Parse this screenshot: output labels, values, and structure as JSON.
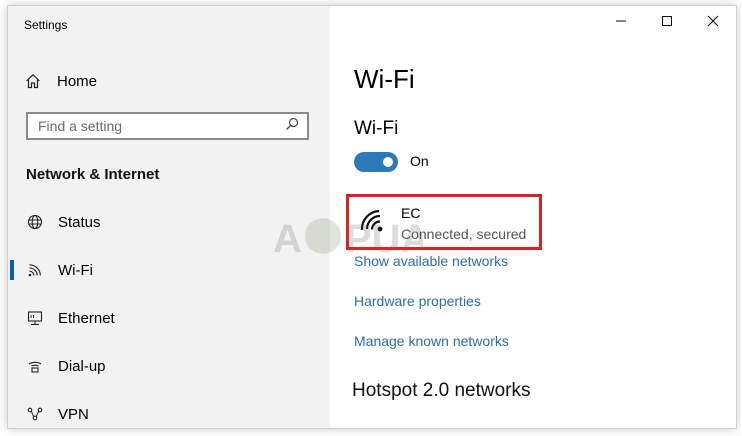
{
  "window": {
    "title": "Settings"
  },
  "titlebar": {
    "minimize_icon": "minimize-icon",
    "maximize_icon": "maximize-icon",
    "close_icon": "close-icon"
  },
  "sidebar": {
    "home": {
      "label": "Home",
      "icon": "home-icon"
    },
    "search": {
      "placeholder": "Find a setting",
      "value": "",
      "icon": "search-icon"
    },
    "section_title": "Network & Internet",
    "items": [
      {
        "label": "Status",
        "icon": "globe-icon",
        "selected": false
      },
      {
        "label": "Wi-Fi",
        "icon": "wifi-icon",
        "selected": true
      },
      {
        "label": "Ethernet",
        "icon": "ethernet-icon",
        "selected": false
      },
      {
        "label": "Dial-up",
        "icon": "dialup-icon",
        "selected": false
      },
      {
        "label": "VPN",
        "icon": "vpn-icon",
        "selected": false
      }
    ]
  },
  "main": {
    "page_title": "Wi-Fi",
    "wifi_section_title": "Wi-Fi",
    "toggle": {
      "state": "On",
      "on": true
    },
    "network": {
      "name": "EC",
      "status": "Connected, secured",
      "icon": "wifi-signal-icon"
    },
    "links": [
      "Show available networks",
      "Hardware properties",
      "Manage known networks"
    ],
    "hotspot_title": "Hotspot 2.0 networks"
  },
  "colors": {
    "accent": "#2b79b8",
    "selection_bar": "#0063b1",
    "link": "#2c6bb5",
    "highlight_border": "#e02020",
    "sidebar_bg": "#f2f2f2"
  }
}
